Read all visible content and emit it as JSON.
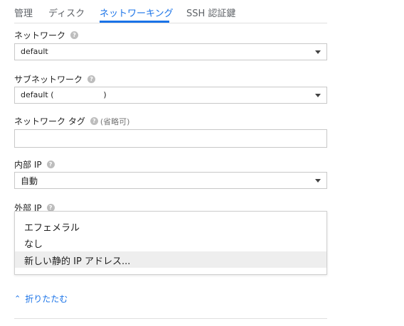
{
  "tabs": {
    "management": "管理",
    "disk": "ディスク",
    "networking": "ネットワーキング",
    "ssh": "SSH 認証鍵"
  },
  "network": {
    "label": "ネットワーク",
    "value": "default"
  },
  "subnetwork": {
    "label": "サブネットワーク",
    "value": "default (                    )"
  },
  "network_tags": {
    "label": "ネットワーク タグ",
    "optional": "(省略可)",
    "value": ""
  },
  "internal_ip": {
    "label": "内部 IP",
    "value": "自動"
  },
  "external_ip": {
    "label": "外部 IP",
    "options": [
      "エフェメラル",
      "なし",
      "新しい静的 IP アドレス..."
    ]
  },
  "collapse": {
    "chevron": "⌃",
    "label": "折りたたむ"
  },
  "colors": {
    "accent": "#1a73e8",
    "highlight": "#eeeeee"
  }
}
